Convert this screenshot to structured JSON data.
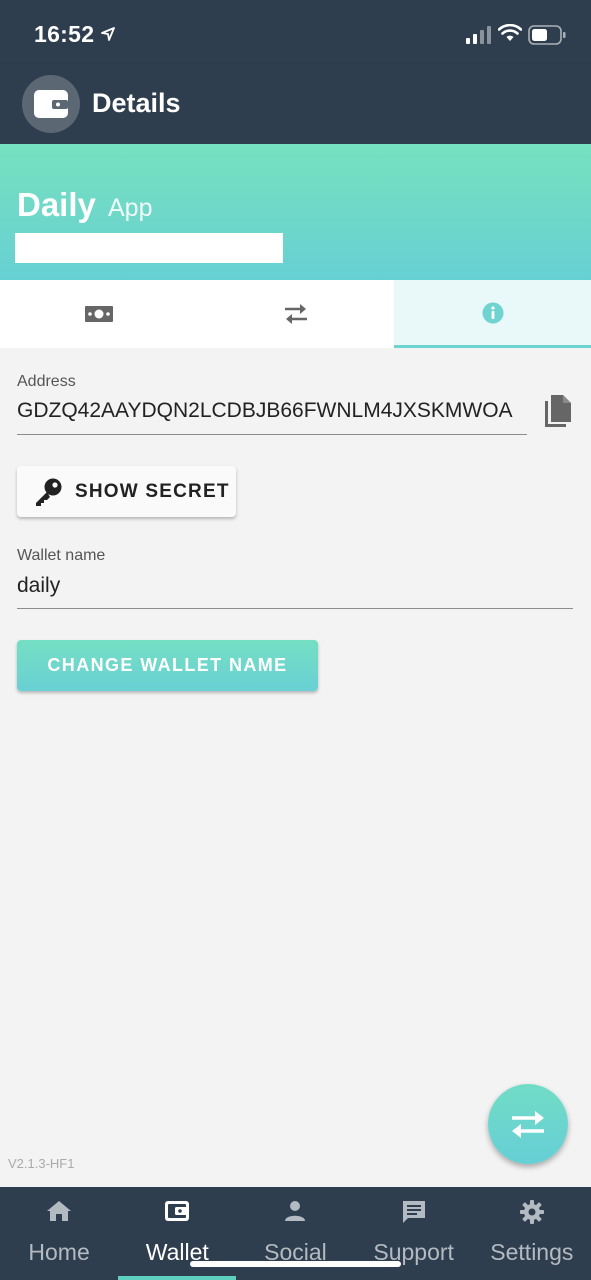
{
  "status_bar": {
    "time": "16:52"
  },
  "app_bar": {
    "title": "Details",
    "icon": "wallet-icon"
  },
  "banner": {
    "name": "Daily",
    "subtitle": "App"
  },
  "tabs": [
    {
      "icon": "money-icon",
      "active": false
    },
    {
      "icon": "transfer-icon",
      "active": false
    },
    {
      "icon": "info-icon",
      "active": true
    }
  ],
  "address": {
    "label": "Address",
    "value": "GDZQ42AAYDQN2LCDBJB66FWNLM4JXSKMWOA"
  },
  "show_secret": {
    "label": "SHOW SECRET",
    "icon": "key-icon"
  },
  "wallet_name": {
    "label": "Wallet name",
    "value": "daily"
  },
  "change_button": {
    "label": "CHANGE WALLET NAME"
  },
  "version": "V2.1.3-HF1",
  "bottom_nav": [
    {
      "label": "Home",
      "icon": "home-icon",
      "active": false
    },
    {
      "label": "Wallet",
      "icon": "wallet-icon",
      "active": true
    },
    {
      "label": "Social",
      "icon": "person-icon",
      "active": false
    },
    {
      "label": "Support",
      "icon": "chat-icon",
      "active": false
    },
    {
      "label": "Settings",
      "icon": "gear-icon",
      "active": false
    }
  ],
  "colors": {
    "dark": "#2f3e4e",
    "accent": "#6fd3d0",
    "accent_green": "#76e2bf"
  }
}
